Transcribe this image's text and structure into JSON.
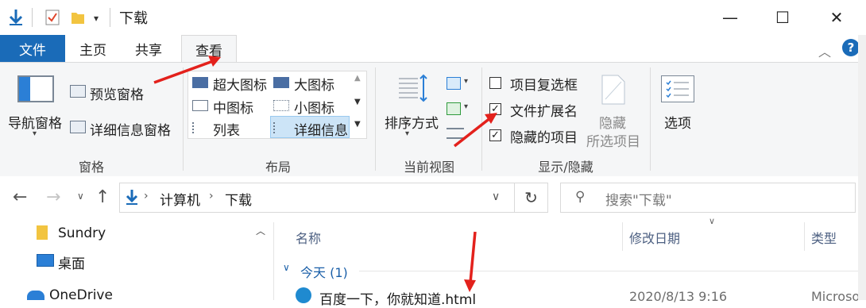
{
  "titlebar": {
    "title": "下载",
    "min_glyph": "—",
    "max_glyph": "☐",
    "close_glyph": "✕"
  },
  "tabs": {
    "file": "文件",
    "home": "主页",
    "share": "共享",
    "view": "查看"
  },
  "ribbon": {
    "pane": {
      "nav_pane": "导航窗格",
      "preview_pane": "预览窗格",
      "details_pane": "详细信息窗格",
      "group_label": "窗格"
    },
    "layout": {
      "extra_large_icons": "超大图标",
      "large_icons": "大图标",
      "medium_icons": "中图标",
      "small_icons": "小图标",
      "list": "列表",
      "details": "详细信息",
      "group_label": "布局"
    },
    "current_view": {
      "sort_by": "排序方式",
      "group_label": "当前视图"
    },
    "show_hide": {
      "item_checkboxes": "项目复选框",
      "file_name_extensions": "文件扩展名",
      "hidden_items": "隐藏的项目",
      "hide_selected_line1": "隐藏",
      "hide_selected_line2": "所选项目",
      "group_label": "显示/隐藏",
      "item_checkboxes_checked": false,
      "file_name_extensions_checked": true,
      "hidden_items_checked": true
    },
    "options": "选项"
  },
  "address": {
    "computer": "计算机",
    "folder": "下载",
    "search_placeholder": "搜索\"下载\""
  },
  "sidebar": {
    "items": [
      {
        "label": "Sundry"
      },
      {
        "label": "桌面"
      },
      {
        "label": "OneDrive"
      }
    ]
  },
  "filelist": {
    "columns": {
      "name": "名称",
      "date_modified": "修改日期",
      "type": "类型"
    },
    "group": "今天 (1)",
    "rows": [
      {
        "name": "百度一下，你就知道.html",
        "date": "2020/8/13 9:16",
        "type": "Microso"
      }
    ]
  },
  "colors": {
    "accent": "#1a6bb8",
    "annotation_red": "#e3211c"
  }
}
